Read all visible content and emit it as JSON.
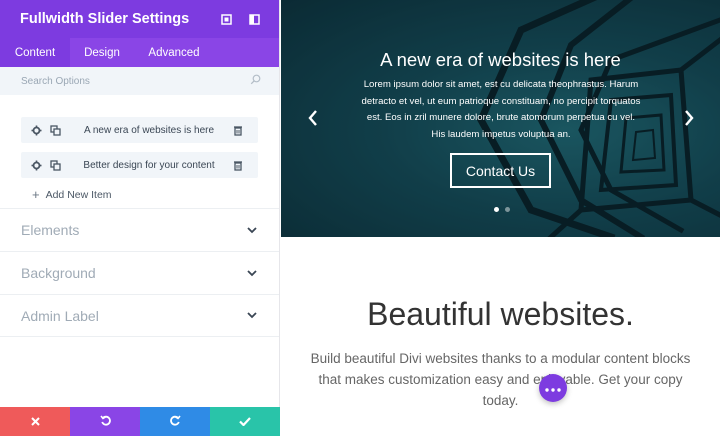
{
  "panel": {
    "title": "Fullwidth Slider Settings",
    "header_icons": [
      "expand-icon",
      "sidebar-toggle-icon"
    ],
    "tabs": [
      {
        "label": "Content",
        "active": true
      },
      {
        "label": "Design",
        "active": false
      },
      {
        "label": "Advanced",
        "active": false
      }
    ],
    "search": {
      "placeholder": "Search Options"
    },
    "items": [
      {
        "label": "A new era of websites is here"
      },
      {
        "label": "Better design for your content"
      }
    ],
    "add_item_label": "Add New Item",
    "sections": [
      {
        "label": "Elements"
      },
      {
        "label": "Background"
      },
      {
        "label": "Admin Label"
      }
    ],
    "footer_buttons": [
      "discard",
      "undo",
      "redo",
      "save"
    ]
  },
  "slide": {
    "title": "A new era of websites is here",
    "body": "Lorem ipsum dolor sit amet, est cu delicata theophrastus. Harum detracto et vel, ut eum patrioque constituam, no percipit torquatos est. Eos in zril munere dolore, brute atomorum perpetua cu vel. His laudem impetus voluptua an.",
    "button_label": "Contact Us",
    "dots": {
      "count": 2,
      "active_index": 0
    }
  },
  "hero": {
    "title": "Beautiful websites.",
    "body": "Build beautiful Divi websites thanks to a modular content blocks that makes customization easy and enjoyable. Get your copy today."
  },
  "colors": {
    "accent": "#7d3be0",
    "tab_bar": "#8a45e6",
    "discard": "#ef5a5a",
    "redo": "#2f8be6",
    "save": "#29c4a9"
  }
}
